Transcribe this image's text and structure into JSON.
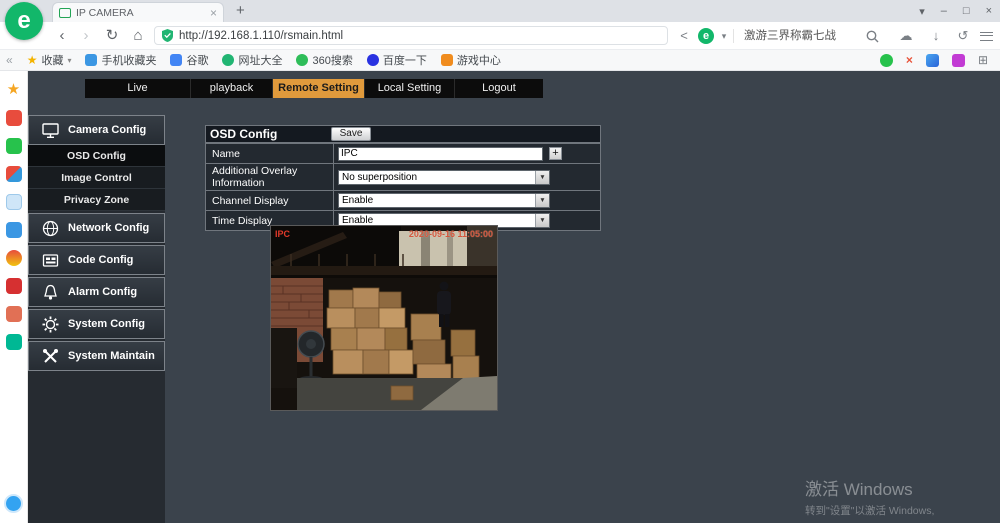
{
  "colors": {
    "logo_green": "#12b76a",
    "accent_orange": "#e09a3c",
    "page_bg": "#3b434c"
  },
  "icons": {
    "back": "‹",
    "forward": "›",
    "refresh": "↻",
    "home": "⌂",
    "close": "×",
    "newtab": "+",
    "min": "–",
    "max": "□",
    "skin": "▾",
    "share": "<",
    "caret": "▾",
    "cloud": "☁",
    "download": "↓",
    "undo": "↺",
    "chevrons_left": "«",
    "star": "★",
    "dropdown": "▼",
    "plus": "+",
    "grid": "⊞",
    "cross": "×",
    "dot": "●",
    "logo_letter": "e"
  },
  "browser": {
    "tab_title": "IP CAMERA",
    "url": "http://192.168.1.110/rsmain.html",
    "hotword": "激游三界称霸七战",
    "bookmarks": [
      {
        "label": "收藏",
        "color": "#f4b400"
      },
      {
        "label": "手机收藏夹",
        "color": "#3b97e3"
      },
      {
        "label": "谷歌",
        "color": "#4285f4"
      },
      {
        "label": "网址大全",
        "color": "#21b573"
      },
      {
        "label": "360搜索",
        "color": "#2ebd59"
      },
      {
        "label": "百度一下",
        "color": "#2932e1"
      },
      {
        "label": "游戏中心",
        "color": "#f08c1e"
      }
    ],
    "ext_colors": {
      "ext1": "#27c24c",
      "ext2": "#e8533a",
      "ext3": "linear-gradient(135deg,#4aa7f0,#2a64d8)",
      "ext4": "#c23bd4"
    }
  },
  "appstrip": {
    "icons": [
      {
        "color": "#e84c3d"
      },
      {
        "color": "#27c24c"
      },
      {
        "color": "linear-gradient(135deg,#e74c3c 50%,#3498db 50%)"
      },
      {
        "color": "#cfe6f8"
      },
      {
        "color": "#3b97e3"
      },
      {
        "color": "linear-gradient(#e74c3c,#f1c40f)"
      },
      {
        "color": "#d63031"
      },
      {
        "color": "#e17055"
      },
      {
        "color": "#00b894"
      }
    ],
    "star_color": "#f5a623"
  },
  "nav": {
    "tabs": [
      {
        "label": "Live"
      },
      {
        "label": "playback"
      },
      {
        "label": "Remote Setting"
      },
      {
        "label": "Local Setting"
      },
      {
        "label": "Logout"
      }
    ]
  },
  "sidebar": {
    "camera_group": "Camera Config",
    "camera_children": [
      {
        "label": "OSD Config"
      },
      {
        "label": "Image Control"
      },
      {
        "label": "Privacy Zone"
      }
    ],
    "groups": [
      {
        "label": "Network Config"
      },
      {
        "label": "Code Config"
      },
      {
        "label": "Alarm Config"
      },
      {
        "label": "System Config"
      },
      {
        "label": "System Maintain"
      }
    ]
  },
  "panel": {
    "title": "OSD Config",
    "save": "Save",
    "rows": [
      {
        "label": "Name",
        "value": "IPC"
      },
      {
        "label": "Additional Overlay Information",
        "value": "No superposition"
      },
      {
        "label": "Channel Display",
        "value": "Enable"
      },
      {
        "label": "Time Display",
        "value": "Enable"
      }
    ]
  },
  "video": {
    "osd_name": "IPC",
    "osd_time": "2020-09-16 11:05:00"
  },
  "watermark": {
    "line1": "激活 Windows",
    "line2": "转到\"设置\"以激活 Windows,"
  }
}
